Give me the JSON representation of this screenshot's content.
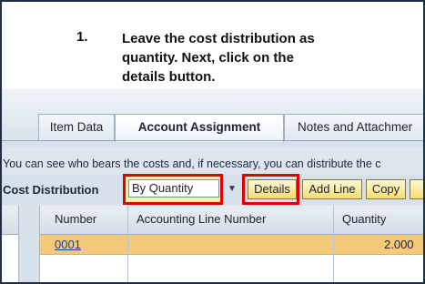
{
  "callout": {
    "number": "1.",
    "text": "Leave the cost distribution as quantity. Next, click on the details button."
  },
  "tabs": [
    {
      "label": "Item Data",
      "active": false
    },
    {
      "label": "Account Assignment",
      "active": true
    },
    {
      "label": "Notes and Attachmer",
      "active": false
    }
  ],
  "info_text": "You can see who bears the costs and, if necessary, you can distribute the c",
  "toolbar": {
    "cost_distribution_label": "Cost Distribution",
    "cost_distribution_value": "By Quantity",
    "details_label": "Details",
    "add_line_label": "Add Line",
    "copy_label": "Copy",
    "dropdown_icon": "triangle-down-icon"
  },
  "table": {
    "columns": [
      "Number",
      "Accounting Line Number",
      "Quantity"
    ],
    "rows": [
      {
        "number": "0001",
        "accounting_line_number": "",
        "quantity": "2.000"
      }
    ]
  },
  "colors": {
    "highlight": "#e00000",
    "selected_row": "#f5c97a",
    "button": "#f2dc73"
  }
}
